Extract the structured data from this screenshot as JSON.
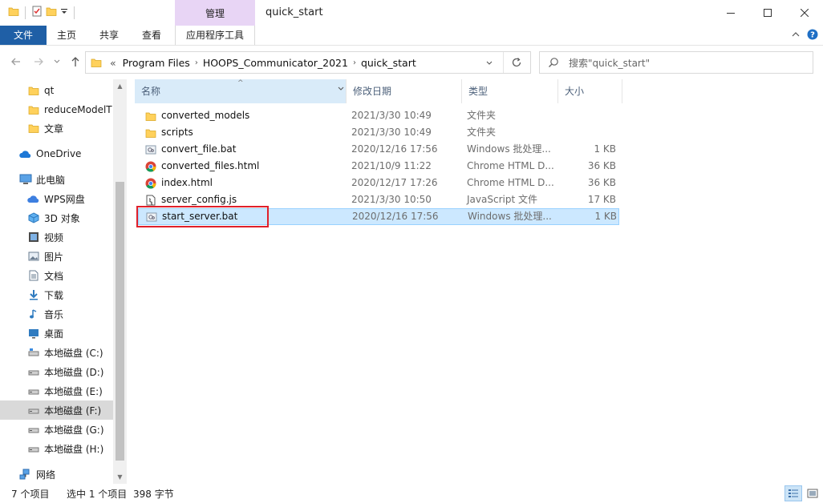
{
  "window": {
    "title": "quick_start",
    "context_tab": "管理"
  },
  "ribbon": {
    "file_tab": "文件",
    "tabs": [
      "主页",
      "共享",
      "查看"
    ],
    "app_tools_tab": "应用程序工具"
  },
  "address": {
    "overflow": "«",
    "crumbs": [
      "Program Files",
      "HOOPS_Communicator_2021",
      "quick_start"
    ]
  },
  "search": {
    "placeholder": "搜索\"quick_start\""
  },
  "sidebar": {
    "items": [
      {
        "label": "qt",
        "icon": "folder-icon"
      },
      {
        "label": "reduceModelT",
        "icon": "folder-icon"
      },
      {
        "label": "文章",
        "icon": "folder-icon"
      },
      {
        "label": "OneDrive",
        "icon": "cloud-icon"
      },
      {
        "label": "此电脑",
        "icon": "computer-icon"
      },
      {
        "label": "WPS网盘",
        "icon": "wps-cloud-icon"
      },
      {
        "label": "3D 对象",
        "icon": "3d-objects-icon"
      },
      {
        "label": "视频",
        "icon": "video-icon"
      },
      {
        "label": "图片",
        "icon": "pictures-icon"
      },
      {
        "label": "文档",
        "icon": "documents-icon"
      },
      {
        "label": "下载",
        "icon": "download-icon"
      },
      {
        "label": "音乐",
        "icon": "music-icon"
      },
      {
        "label": "桌面",
        "icon": "desktop-icon"
      },
      {
        "label": "本地磁盘 (C:)",
        "icon": "drive-icon"
      },
      {
        "label": "本地磁盘 (D:)",
        "icon": "drive-icon"
      },
      {
        "label": "本地磁盘 (E:)",
        "icon": "drive-icon"
      },
      {
        "label": "本地磁盘 (F:)",
        "icon": "drive-icon"
      },
      {
        "label": "本地磁盘 (G:)",
        "icon": "drive-icon"
      },
      {
        "label": "本地磁盘 (H:)",
        "icon": "drive-icon"
      },
      {
        "label": "网络",
        "icon": "network-icon"
      }
    ],
    "selected_label": "本地磁盘 (F:)"
  },
  "columns": {
    "name": "名称",
    "date": "修改日期",
    "type": "类型",
    "size": "大小"
  },
  "files": [
    {
      "name": "converted_models",
      "date": "2021/3/30 10:49",
      "type": "文件夹",
      "size": "",
      "icon": "folder-icon"
    },
    {
      "name": "scripts",
      "date": "2021/3/30 10:49",
      "type": "文件夹",
      "size": "",
      "icon": "folder-icon"
    },
    {
      "name": "convert_file.bat",
      "date": "2020/12/16 17:56",
      "type": "Windows 批处理...",
      "size": "1 KB",
      "icon": "batch-file-icon"
    },
    {
      "name": "converted_files.html",
      "date": "2021/10/9 11:22",
      "type": "Chrome HTML D...",
      "size": "36 KB",
      "icon": "chrome-icon"
    },
    {
      "name": "index.html",
      "date": "2020/12/17 17:26",
      "type": "Chrome HTML D...",
      "size": "36 KB",
      "icon": "chrome-icon"
    },
    {
      "name": "server_config.js",
      "date": "2021/3/30 10:50",
      "type": "JavaScript 文件",
      "size": "17 KB",
      "icon": "script-file-icon"
    },
    {
      "name": "start_server.bat",
      "date": "2020/12/16 17:56",
      "type": "Windows 批处理...",
      "size": "1 KB",
      "icon": "batch-file-icon"
    }
  ],
  "selected_file": "start_server.bat",
  "status": {
    "count": "7 个项目",
    "selection": "选中 1 个项目",
    "size": "398 字节"
  },
  "colors": {
    "file_tab": "#1f5fa6",
    "context_tab": "#e8d5f5",
    "selection": "#cce8ff",
    "highlight_border": "#e0202a",
    "folder": "#ffd15c"
  }
}
